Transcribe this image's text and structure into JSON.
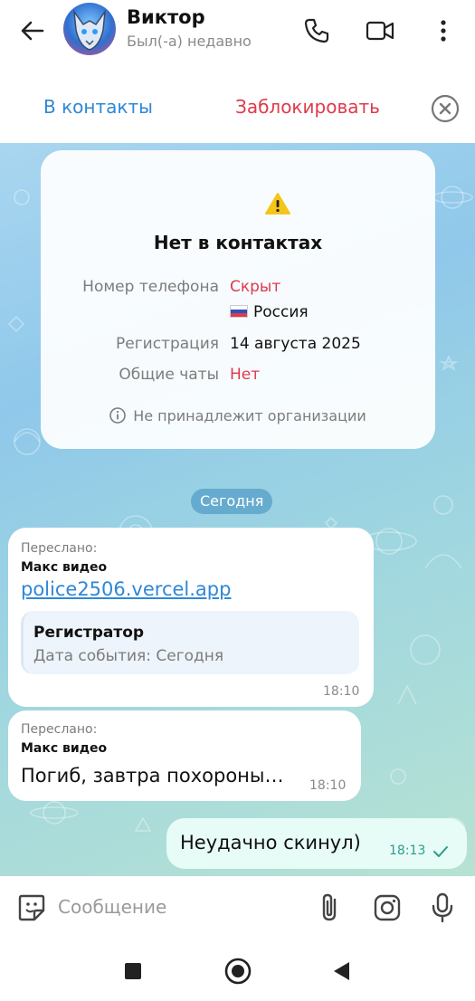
{
  "header": {
    "name": "Виктор",
    "status": "Был(-а) недавно",
    "icons": [
      "back-arrow-icon",
      "phone-icon",
      "video-call-icon",
      "more-vert-icon"
    ]
  },
  "actionbar": {
    "add_contact": "В контакты",
    "block": "Заблокировать"
  },
  "info_card": {
    "title": "Нет в контактах",
    "phone_label": "Номер телефона",
    "phone_value": "Скрыт",
    "country": "Россия",
    "registration_label": "Регистрация",
    "registration_value": "14 августа 2025",
    "common_chats_label": "Общие чаты",
    "common_chats_value": "Нет",
    "organization": "Не принадлежит организации"
  },
  "chat": {
    "date_separator": "Сегодня",
    "messages": [
      {
        "forwarded_label": "Переслано:",
        "forwarded_from": "Макс видео",
        "link": "police2506.vercel.app",
        "preview_title": "Регистратор",
        "preview_desc": "Дата события: Сегодня",
        "time": "18:10"
      },
      {
        "forwarded_label": "Переслано:",
        "forwarded_from": "Макс видео",
        "text": "Погиб, завтра похороны…",
        "time": "18:10"
      },
      {
        "text": "Неудачно скинул)",
        "time": "18:13",
        "status": "sent"
      }
    ]
  },
  "input": {
    "placeholder": "Сообщение"
  },
  "colors": {
    "accent": "#2f87d6",
    "danger": "#e0394a",
    "outgoing_bubble": "#e7fbf7",
    "outgoing_time": "#2a9c8e"
  }
}
